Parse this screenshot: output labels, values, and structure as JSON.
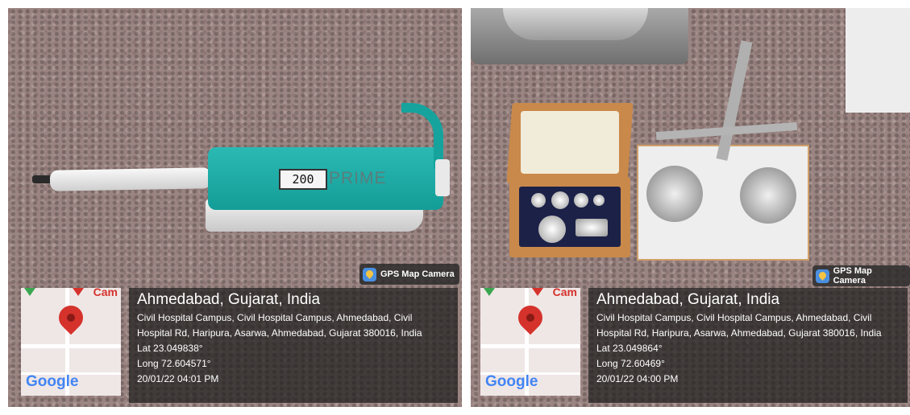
{
  "panels": [
    {
      "pipette": {
        "display": "200",
        "brand": "PRIME"
      },
      "badge": "GPS Map Camera",
      "map": {
        "cam_label": "Cam",
        "google": "Google"
      },
      "city": "Ahmedabad, Gujarat, India",
      "address_line1": "Civil Hospital Campus, Civil Hospital Campus, Ahmedabad, Civil",
      "address_line2": "Hospital Rd, Haripura, Asarwa, Ahmedabad, Gujarat 380016, India",
      "lat": "Lat 23.049838°",
      "long": "Long 72.604571°",
      "datetime": "20/01/22 04:01 PM"
    },
    {
      "badge": "GPS Map Camera",
      "map": {
        "cam_label": "Cam",
        "google": "Google"
      },
      "city": "Ahmedabad, Gujarat, India",
      "address_line1": "Civil Hospital Campus, Civil Hospital Campus, Ahmedabad, Civil",
      "address_line2": "Hospital Rd, Haripura, Asarwa, Ahmedabad, Gujarat 380016, India",
      "lat": "Lat 23.049864°",
      "long": "Long 72.60469°",
      "datetime": "20/01/22 04:00 PM"
    }
  ],
  "colors": {
    "pin": "#d5322c",
    "pipette_body": "#1aa9a3",
    "box_wood": "#c9894a"
  }
}
